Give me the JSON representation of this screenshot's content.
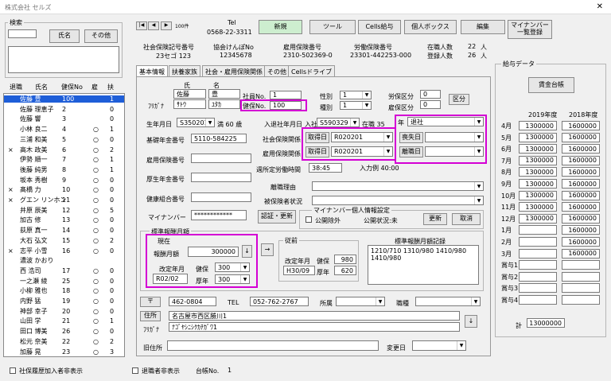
{
  "window": {
    "title": "株式会社 セルズ",
    "close": "✕"
  },
  "search": {
    "title": "検索",
    "name_btn": "氏名",
    "other_btn": "その他"
  },
  "list": {
    "headers": [
      "退職",
      "氏名",
      "健保No",
      "雇",
      "扶"
    ],
    "rows": [
      [
        "",
        "佐藤 豊",
        "100",
        "",
        "1"
      ],
      [
        "",
        "佐藤 理恵子",
        "2",
        "",
        "0"
      ],
      [
        "",
        "佐藤 響",
        "3",
        "",
        "0"
      ],
      [
        "",
        "小林 良二",
        "4",
        "○",
        "1"
      ],
      [
        "",
        "三浦 和美",
        "5",
        "○",
        "0"
      ],
      [
        "×",
        "高木 政美",
        "6",
        "○",
        "2"
      ],
      [
        "",
        "伊勢 順一",
        "7",
        "○",
        "1"
      ],
      [
        "",
        "後藤 純男",
        "8",
        "○",
        "1"
      ],
      [
        "",
        "坂本 秀樹",
        "9",
        "○",
        "0"
      ],
      [
        "×",
        "髙橋 力",
        "10",
        "○",
        "0"
      ],
      [
        "×",
        "グエン リンホン",
        "11",
        "○",
        "0"
      ],
      [
        "",
        "井原 辰美",
        "12",
        "○",
        "5"
      ],
      [
        "",
        "加古 修",
        "13",
        "○",
        "0"
      ],
      [
        "",
        "荻原 真一",
        "14",
        "○",
        "0"
      ],
      [
        "",
        "大石 弘文",
        "15",
        "○",
        "2"
      ],
      [
        "×",
        "志平 小雪",
        "16",
        "○",
        "0"
      ],
      [
        "",
        "濃波 かおり",
        "",
        "",
        ""
      ],
      [
        "",
        "西 浩司",
        "17",
        "○",
        "0"
      ],
      [
        "",
        "一之瀬 綾",
        "25",
        "○",
        "0"
      ],
      [
        "",
        "小柳 雅也",
        "18",
        "○",
        "0"
      ],
      [
        "",
        "内野 猛",
        "19",
        "○",
        "0"
      ],
      [
        "",
        "神部 幸子",
        "20",
        "○",
        "0"
      ],
      [
        "",
        "山田 学",
        "21",
        "○",
        "1"
      ],
      [
        "",
        "田口 博美",
        "26",
        "○",
        "0"
      ],
      [
        "",
        "松元 奈美",
        "22",
        "○",
        "2"
      ],
      [
        "",
        "加藤 晃",
        "23",
        "○",
        "3"
      ]
    ]
  },
  "bottom": {
    "hide_social": "社保履歴加入者非表示",
    "hide_retired": "退職者非表示",
    "ledger_label": "台帳No.",
    "ledger_value": "1"
  },
  "nav": {
    "first": "|◀",
    "prev": "◀",
    "next": "▶",
    "last": "▶|",
    "record": "100件"
  },
  "tel": {
    "label": "Tel",
    "value": "0568-22-3311"
  },
  "toolbar": {
    "new": "新規",
    "tools": "ツール",
    "cells_pay": "Cells給与",
    "personal_box": "個人ボックス",
    "edit": "編集",
    "mynumber": "マイナンバー\n一覧登録"
  },
  "company": {
    "social_no_label": "社会保険記号番号",
    "social_no": "23セゴ 123",
    "kenpo_label": "協会けんぽNo",
    "kenpo": "12345678",
    "employ_label": "雇用保険番号",
    "employ": "2310-502369-0",
    "labor_label": "労働保険番号",
    "labor": "23301-442253-000",
    "count_label1": "在職人数",
    "count1": "22",
    "count_unit1": "人",
    "count_label2": "登録人数",
    "count2": "26",
    "count_unit2": "人"
  },
  "tabs": [
    "基本情報",
    "扶養家族",
    "社会・雇用保険関係",
    "その他",
    "Cellsドライブ"
  ],
  "person": {
    "shi": "氏",
    "mei": "名",
    "kanji_last": "佐藤",
    "kanji_first": "豊",
    "furigana_label": "ﾌﾘｶﾞﾅ",
    "kana_last": "ｻﾄｳ",
    "kana_first": "ﾕﾀｶ",
    "emp_no_label": "社員No.",
    "emp_no": "1",
    "kenpo_no_label": "健保No.",
    "kenpo_no": "100",
    "gender_label": "性別",
    "gender": "1",
    "type_label": "種別",
    "type": "1",
    "worker_label": "労保区分",
    "worker": "0",
    "employ_label": "雇保区分",
    "employ": "0",
    "kubun_btn": "区分"
  },
  "birth": {
    "label": "生年月日",
    "value": "S350201",
    "age": "満 60  歳",
    "join_label": "入退社年月日",
    "join_prefix": "入社",
    "join": "S590329",
    "tenure": "在職 35",
    "tenure_unit": "年",
    "status": "退社"
  },
  "pension": {
    "label": "基礎年金番号",
    "value": "5110-584225"
  },
  "social": {
    "label": "社会保険関係",
    "btn": "取得日",
    "value": "R020201",
    "loss_btn": "喪失日"
  },
  "employ_rel": {
    "label": "雇用保険関係",
    "btn": "取得日",
    "value": "R020201",
    "leave_btn": "離職日"
  },
  "fields": {
    "employ_no": "雇用保険番号",
    "weekly_label": "週所定労働時間",
    "weekly": "38:45",
    "input_label": "入力例 40:00",
    "kosei_no": "厚生年金番号",
    "leave_reason": "離職理由",
    "kenpo_kumiai": "健康組合番号",
    "disability": "被保険者状況",
    "mynumber_label": "マイナンバー",
    "mynumber": "************"
  },
  "mynumber_info": {
    "auth_btn": "認証・更新",
    "title": "マイナンバー個人情報設定",
    "exclude": "公開除外",
    "status": "公開状況:未",
    "update": "更新",
    "cancel": "取消"
  },
  "std": {
    "title": "標準報酬月額",
    "current": "現在",
    "monthly_label": "報酬月額",
    "monthly": "300000",
    "revise_label": "改定年月",
    "revise": "R02/02",
    "health_label": "健保",
    "health": "300",
    "pension_label": "厚年",
    "pension": "300",
    "prev_title": "従前",
    "prev_revise": "H30/09",
    "prev_health": "980",
    "prev_pension": "620",
    "history_title": "標準報酬月額記録",
    "history": "1210/710  1310/980 1410/980\n1410/980"
  },
  "address": {
    "post_btn": "〒",
    "post": "462-0804",
    "tel_label": "TEL",
    "tel": "052-762-2767",
    "belong_label": "所属",
    "role_label": "職種",
    "addr_btn": "住所",
    "addr": "名古屋市西区勝川1",
    "furi_label": "ﾌﾘｶﾞﾅ",
    "furi": "ﾅｺﾞﾔｼﾆｼｸｶﾁｶﾞﾜ1",
    "old_label": "旧住所",
    "change_label": "変更日"
  },
  "payroll": {
    "title": "給与データ",
    "ledger_btn": "賃金台帳",
    "year1": "2019年度",
    "year2": "2018年度",
    "months": [
      "4月",
      "5月",
      "6月",
      "7月",
      "8月",
      "9月",
      "10月",
      "11月",
      "12月",
      "1月",
      "2月",
      "3月",
      "賞与1",
      "賞与2",
      "賞与3",
      "賞与4"
    ],
    "v2019": [
      "1300000",
      "1300000",
      "1300000",
      "1300000",
      "1300000",
      "1300000",
      "1300000",
      "1300000",
      "1300000",
      "",
      "",
      "",
      "",
      "",
      "",
      ""
    ],
    "v2018": [
      "1600000",
      "1600000",
      "1600000",
      "1600000",
      "1600000",
      "1600000",
      "1600000",
      "1600000",
      "1600000",
      "1600000",
      "1600000",
      "1600000",
      "",
      "",
      "",
      ""
    ],
    "total_label": "計",
    "total": "13000000"
  }
}
